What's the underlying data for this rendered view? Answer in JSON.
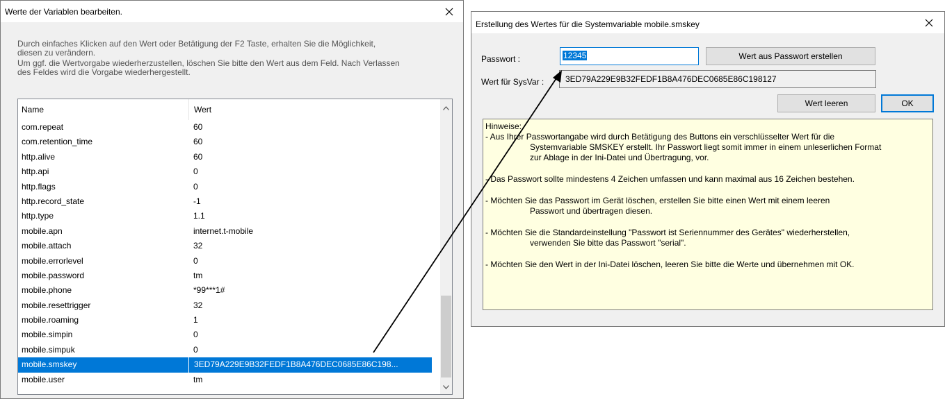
{
  "left_dialog": {
    "title": "Werte der Variablen bearbeiten.",
    "description": [
      "Durch einfaches Klicken auf den Wert oder Betätigung der F2 Taste, erhalten Sie die Möglichkeit,",
      "diesen zu verändern.",
      "Um ggf. die Wertvorgabe wiederherzustellen, löschen Sie bitte den Wert aus dem Feld. Nach Verlassen",
      "des Feldes wird die Vorgabe wiederhergestellt."
    ],
    "columns": [
      "Name",
      "Wert"
    ],
    "rows": [
      {
        "name": "com.repeat",
        "value": "60"
      },
      {
        "name": "com.retention_time",
        "value": "60"
      },
      {
        "name": "http.alive",
        "value": "60"
      },
      {
        "name": "http.api",
        "value": "0"
      },
      {
        "name": "http.flags",
        "value": "0"
      },
      {
        "name": "http.record_state",
        "value": "-1"
      },
      {
        "name": "http.type",
        "value": "1.1"
      },
      {
        "name": "mobile.apn",
        "value": "internet.t-mobile"
      },
      {
        "name": "mobile.attach",
        "value": "32"
      },
      {
        "name": "mobile.errorlevel",
        "value": "0"
      },
      {
        "name": "mobile.password",
        "value": "tm"
      },
      {
        "name": "mobile.phone",
        "value": "*99***1#"
      },
      {
        "name": "mobile.resettrigger",
        "value": "32"
      },
      {
        "name": "mobile.roaming",
        "value": "1"
      },
      {
        "name": "mobile.simpin",
        "value": "0"
      },
      {
        "name": "mobile.simpuk",
        "value": "0"
      },
      {
        "name": "mobile.smskey",
        "value": "3ED79A229E9B32FEDF1B8A476DEC0685E86C198...",
        "selected": true
      },
      {
        "name": "mobile.user",
        "value": "tm"
      }
    ],
    "selected_color": "#0078d7"
  },
  "right_dialog": {
    "title": "Erstellung des Wertes für die Systemvariable mobile.smskey",
    "password_label": "Passwort :",
    "password_value": "12345",
    "create_button": "Wert aus Passwort erstellen",
    "sysvar_label": "Wert für SysVar :",
    "sysvar_value": "3ED79A229E9B32FEDF1B8A476DEC0685E86C198127",
    "clear_button": "Wert leeren",
    "ok_button": "OK",
    "hints": {
      "heading": "Hinweise:",
      "line1a": "- Aus Ihrer Passwortangabe wird durch Betätigung des Buttons ein verschlüsselter Wert für die",
      "line1b": "Systemvariable SMSKEY erstellt. Ihr Passwort liegt somit immer in einem unleserlichen Format",
      "line1c": "zur Ablage in der Ini-Datei und Übertragung, vor.",
      "line2": "- Das Passwort sollte mindestens 4 Zeichen umfassen und kann maximal aus 16 Zeichen bestehen.",
      "line3a": "- Möchten Sie das Passwort im Gerät löschen, erstellen Sie bitte einen Wert mit einem leeren",
      "line3b": "Passwort und übertragen diesen.",
      "line4a": "- Möchten Sie die Standardeinstellung \"Passwort ist Seriennummer des Gerätes\" wiederherstellen,",
      "line4b": "verwenden Sie bitte das Passwort \"serial\".",
      "line5": "- Möchten Sie den Wert in der Ini-Datei löschen, leeren Sie bitte die Werte und übernehmen mit OK."
    },
    "hint_background": "#ffffe1"
  },
  "icons": {
    "close": "close-icon",
    "scroll_up": "chevron-up-icon",
    "scroll_down": "chevron-down-icon",
    "annotation": "annotation-arrow"
  }
}
